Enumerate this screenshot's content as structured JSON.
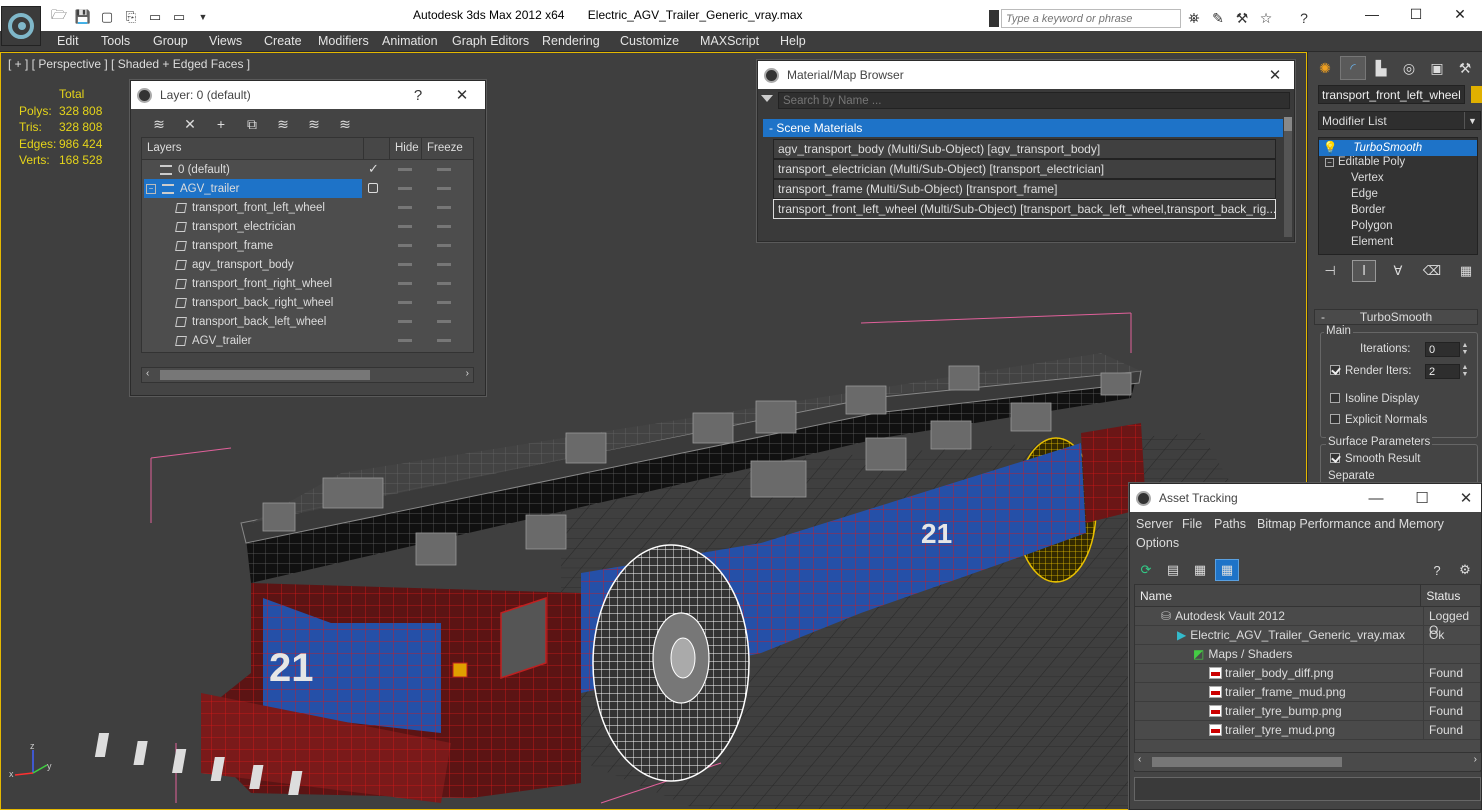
{
  "app": {
    "title": "Autodesk 3ds Max  2012 x64",
    "file": "Electric_AGV_Trailer_Generic_vray.max",
    "search_placeholder": "Type a keyword or phrase"
  },
  "menu": [
    "Edit",
    "Tools",
    "Group",
    "Views",
    "Create",
    "Modifiers",
    "Animation",
    "Graph Editors",
    "Rendering",
    "Customize",
    "MAXScript",
    "Help"
  ],
  "viewport": {
    "label": "[ + ] [ Perspective ] [ Shaded + Edged Faces ]",
    "stats_header": "Total",
    "stats": [
      {
        "k": "Polys:",
        "v": "328 808"
      },
      {
        "k": "Tris:",
        "v": "328 808"
      },
      {
        "k": "Edges:",
        "v": "986 424"
      },
      {
        "k": "Verts:",
        "v": "168 528"
      }
    ],
    "axis": {
      "x": "x",
      "y": "y",
      "z": "z"
    }
  },
  "layer_window": {
    "title": "Layer: 0 (default)",
    "help": "?",
    "col_layers": "Layers",
    "col_hide": "Hide",
    "col_freeze": "Freeze",
    "rows": [
      {
        "name": "0 (default)",
        "kind": "layer",
        "current": true,
        "selected": false,
        "indent": 0
      },
      {
        "name": "AGV_trailer",
        "kind": "layer",
        "current": false,
        "selected": true,
        "indent": 0
      },
      {
        "name": "transport_front_left_wheel",
        "kind": "object",
        "indent": 1
      },
      {
        "name": "transport_electrician",
        "kind": "object",
        "indent": 1
      },
      {
        "name": "transport_frame",
        "kind": "object",
        "indent": 1
      },
      {
        "name": "agv_transport_body",
        "kind": "object",
        "indent": 1
      },
      {
        "name": "transport_front_right_wheel",
        "kind": "object",
        "indent": 1
      },
      {
        "name": "transport_back_right_wheel",
        "kind": "object",
        "indent": 1
      },
      {
        "name": "transport_back_left_wheel",
        "kind": "object",
        "indent": 1
      },
      {
        "name": "AGV_trailer",
        "kind": "object",
        "indent": 1
      }
    ]
  },
  "material_browser": {
    "title": "Material/Map Browser",
    "search_placeholder": "Search by Name ...",
    "group": "- Scene Materials",
    "items": [
      "agv_transport_body (Multi/Sub-Object) [agv_transport_body]",
      "transport_electrician (Multi/Sub-Object) [transport_electrician]",
      "transport_frame (Multi/Sub-Object) [transport_frame]",
      "transport_front_left_wheel (Multi/Sub-Object) [transport_back_left_wheel,transport_back_rig..."
    ]
  },
  "command_panel": {
    "object_name": "transport_front_left_wheel",
    "object_color": "#e0b000",
    "modifier_list": "Modifier List",
    "stack": [
      {
        "label": "TurboSmooth",
        "level": 0,
        "selected": true
      },
      {
        "label": "Editable Poly",
        "level": 0,
        "selected": false
      },
      {
        "label": "Vertex",
        "level": 1
      },
      {
        "label": "Edge",
        "level": 1
      },
      {
        "label": "Border",
        "level": 1
      },
      {
        "label": "Polygon",
        "level": 1
      },
      {
        "label": "Element",
        "level": 1
      }
    ],
    "rollout_title": "TurboSmooth",
    "main_group": "Main",
    "iterations_label": "Iterations:",
    "iterations_value": "0",
    "render_iters_label": "Render Iters:",
    "render_iters_value": "2",
    "isoline": "Isoline Display",
    "explicit_normals": "Explicit Normals",
    "surface_group": "Surface Parameters",
    "smooth_result": "Smooth Result",
    "separate": "Separate"
  },
  "asset_tracking": {
    "title": "Asset Tracking",
    "menu": [
      "Server",
      "File",
      "Paths",
      "Bitmap Performance and Memory",
      "Options"
    ],
    "col_name": "Name",
    "col_status": "Status",
    "rows": [
      {
        "name": "Autodesk Vault 2012",
        "status": "Logged O",
        "indent": 0,
        "icon": "vault"
      },
      {
        "name": "Electric_AGV_Trailer_Generic_vray.max",
        "status": "Ok",
        "indent": 1,
        "icon": "max"
      },
      {
        "name": "Maps / Shaders",
        "status": "",
        "indent": 2,
        "icon": "maps"
      },
      {
        "name": "trailer_body_diff.png",
        "status": "Found",
        "indent": 3,
        "icon": "png"
      },
      {
        "name": "trailer_frame_mud.png",
        "status": "Found",
        "indent": 3,
        "icon": "png"
      },
      {
        "name": "trailer_tyre_bump.png",
        "status": "Found",
        "indent": 3,
        "icon": "png"
      },
      {
        "name": "trailer_tyre_mud.png",
        "status": "Found",
        "indent": 3,
        "icon": "png"
      }
    ]
  },
  "colors": {
    "accent_blue": "#1e73c8",
    "stats_yellow": "#e5d41a",
    "viewport_border": "#e4b800"
  }
}
